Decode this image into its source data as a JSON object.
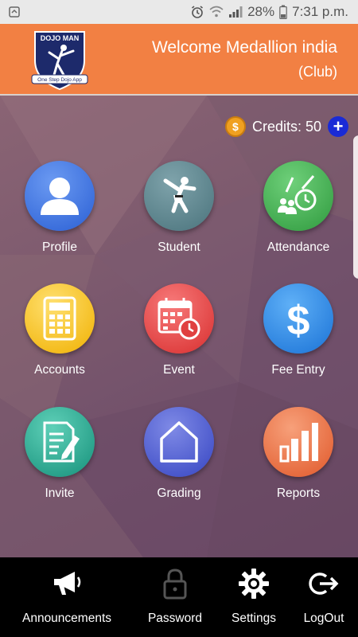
{
  "status_bar": {
    "battery": "28%",
    "time": "7:31 p.m."
  },
  "header": {
    "logo": {
      "title": "DOJO MAN",
      "tagline": "One Step Dojo App"
    },
    "welcome": "Welcome Medallion india",
    "role": "(Club)"
  },
  "credits": {
    "label": "Credits: 50",
    "coin_symbol": "$",
    "add_symbol": "+"
  },
  "tiles": [
    {
      "label": "Profile",
      "icon": "person-icon",
      "color": "#3d6fe0"
    },
    {
      "label": "Student",
      "icon": "karate-kick-icon",
      "color": "#5e8a93"
    },
    {
      "label": "Attendance",
      "icon": "attendance-icon",
      "color": "#3fb34f"
    },
    {
      "label": "Accounts",
      "icon": "calculator-icon",
      "color": "#f4c020"
    },
    {
      "label": "Event",
      "icon": "calendar-clock-icon",
      "color": "#e54848"
    },
    {
      "label": "Fee Entry",
      "icon": "dollar-icon",
      "color": "#2a8be6"
    },
    {
      "label": "Invite",
      "icon": "invite-icon",
      "color": "#2aa893"
    },
    {
      "label": "Grading",
      "icon": "house-icon",
      "color": "#4d5bd1"
    },
    {
      "label": "Reports",
      "icon": "bar-chart-icon",
      "color": "#f0774a"
    }
  ],
  "bottom_nav": [
    {
      "label": "Announcements",
      "icon": "megaphone-icon"
    },
    {
      "label": "Password",
      "icon": "lock-icon"
    },
    {
      "label": "Settings",
      "icon": "gear-icon"
    },
    {
      "label": "LogOut",
      "icon": "logout-icon"
    }
  ]
}
